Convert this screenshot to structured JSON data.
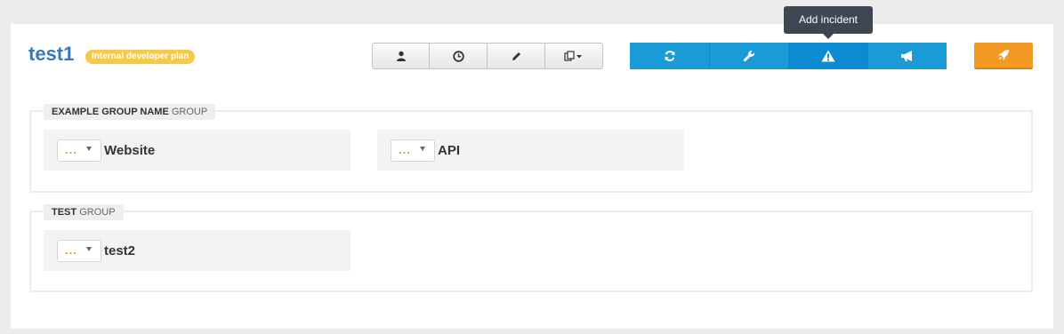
{
  "page": {
    "title": "test1",
    "plan_badge": "Internal developer plan"
  },
  "toolbar_grey": [
    {
      "icon": "user-icon",
      "glyph": "👤"
    },
    {
      "icon": "clock-icon",
      "glyph": "◷"
    },
    {
      "icon": "pencil-icon",
      "glyph": "✎"
    },
    {
      "icon": "copy-dropdown-icon",
      "glyph": "⧉▾"
    }
  ],
  "toolbar_blue": [
    {
      "icon": "refresh-icon",
      "glyph": "⟳"
    },
    {
      "icon": "wrench-icon",
      "glyph": "🔧"
    },
    {
      "icon": "warning-icon",
      "glyph": "⚠"
    },
    {
      "icon": "megaphone-icon",
      "glyph": "📢"
    }
  ],
  "launch_button": {
    "icon": "rocket-icon",
    "glyph": "🚀"
  },
  "tooltip": {
    "text": "Add incident"
  },
  "groups": [
    {
      "name": "EXAMPLE GROUP NAME",
      "suffix": "GROUP",
      "components": [
        {
          "status": "...",
          "name": "Website",
          "status_color": "#a8b84a"
        },
        {
          "status": "...",
          "name": "API",
          "status_color": "#a8b84a"
        }
      ]
    },
    {
      "name": "TEST",
      "suffix": "GROUP",
      "components": [
        {
          "status": "...",
          "name": "test2",
          "status_color": "#f0902a"
        }
      ]
    }
  ],
  "colors": {
    "title": "#3a7ab8",
    "badge": "#f6c94a",
    "blue_button": "#1a9ad6",
    "orange_button": "#f39a24",
    "tooltip": "#3d4652"
  }
}
